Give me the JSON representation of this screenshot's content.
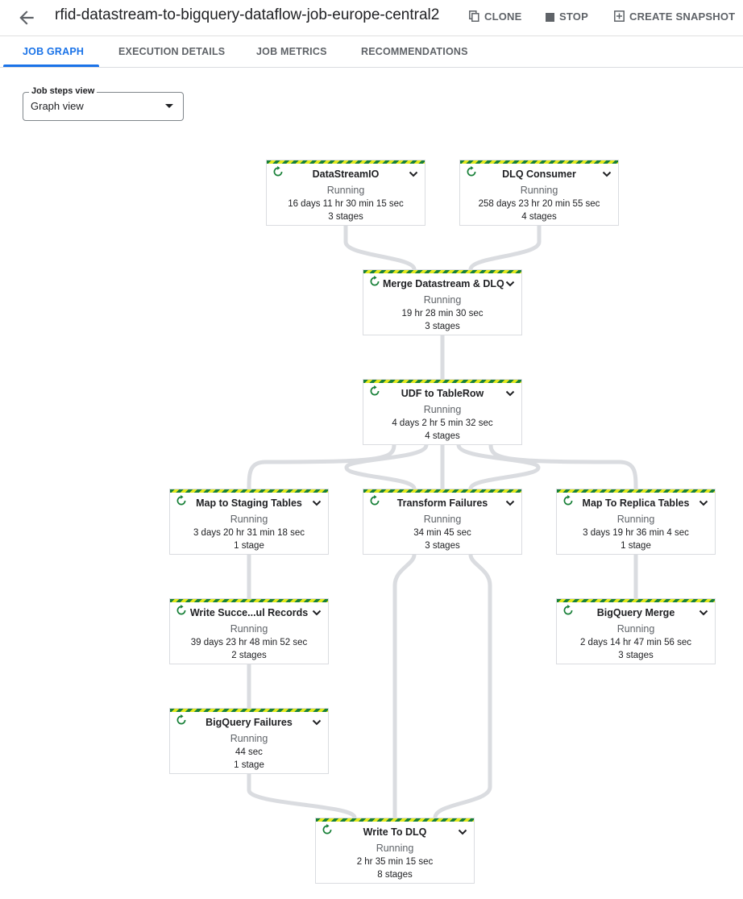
{
  "header": {
    "job_title": "rfid-datastream-to-bigquery-dataflow-job-europe-central2",
    "clone_label": "CLONE",
    "stop_label": "STOP",
    "snapshot_label": "CREATE SNAPSHOT"
  },
  "tabs": [
    {
      "label": "JOB GRAPH",
      "active": true
    },
    {
      "label": "EXECUTION DETAILS",
      "active": false
    },
    {
      "label": "JOB METRICS",
      "active": false
    },
    {
      "label": "RECOMMENDATIONS",
      "active": false
    }
  ],
  "steps_view": {
    "label": "Job steps view",
    "value": "Graph view"
  },
  "colors": {
    "accent": "#1a73e8",
    "running_green": "#188038",
    "stripe_yellow": "#e3e91b"
  },
  "nodes": [
    {
      "name": "DataStreamIO",
      "status": "Running",
      "duration": "16 days 11 hr 30 min 15 sec",
      "stages": "3 stages"
    },
    {
      "name": "DLQ Consumer",
      "status": "Running",
      "duration": "258 days 23 hr 20 min 55 sec",
      "stages": "4 stages"
    },
    {
      "name": "Merge Datastream & DLQ",
      "status": "Running",
      "duration": "19 hr 28 min 30 sec",
      "stages": "3 stages"
    },
    {
      "name": "UDF to TableRow",
      "status": "Running",
      "duration": "4 days 2 hr 5 min 32 sec",
      "stages": "4 stages"
    },
    {
      "name": "Map to Staging Tables",
      "status": "Running",
      "duration": "3 days 20 hr 31 min 18 sec",
      "stages": "1 stage"
    },
    {
      "name": "Transform Failures",
      "status": "Running",
      "duration": "34 min 45 sec",
      "stages": "3 stages"
    },
    {
      "name": "Map To Replica Tables",
      "status": "Running",
      "duration": "3 days 19 hr 36 min 4 sec",
      "stages": "1 stage"
    },
    {
      "name": "Write Succe...ul Records",
      "status": "Running",
      "duration": "39 days 23 hr 48 min 52 sec",
      "stages": "2 stages"
    },
    {
      "name": "BigQuery Merge",
      "status": "Running",
      "duration": "2 days 14 hr 47 min 56 sec",
      "stages": "3 stages"
    },
    {
      "name": "BigQuery Failures",
      "status": "Running",
      "duration": "44 sec",
      "stages": "1 stage"
    },
    {
      "name": "Write To DLQ",
      "status": "Running",
      "duration": "2 hr 35 min 15 sec",
      "stages": "8 stages"
    }
  ]
}
